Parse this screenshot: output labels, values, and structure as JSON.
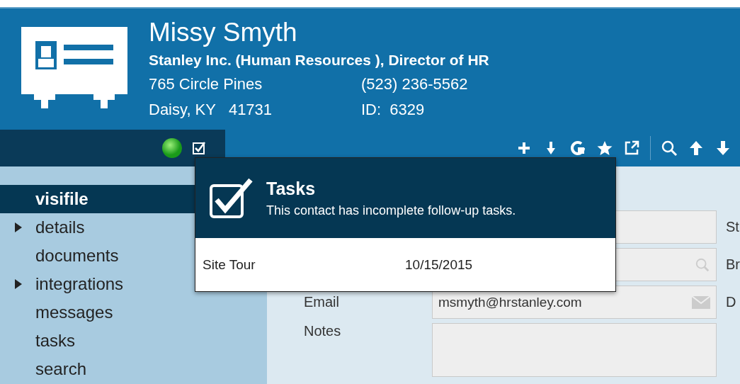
{
  "contact": {
    "name": "Missy Smyth",
    "company_line": "Stanley Inc.  (Human Resources ), Director of HR",
    "address_1": "765 Circle Pines",
    "address_2": "Daisy, KY   41731",
    "phone": "(523) 236-5562",
    "id": "ID:  6329"
  },
  "sidebar": {
    "items": [
      {
        "label": "visifile",
        "selected": true,
        "expandable": false
      },
      {
        "label": "details",
        "selected": false,
        "expandable": true
      },
      {
        "label": "documents",
        "selected": false,
        "expandable": false
      },
      {
        "label": "integrations",
        "selected": false,
        "expandable": true
      },
      {
        "label": "messages",
        "selected": false,
        "expandable": false
      },
      {
        "label": "tasks",
        "selected": false,
        "expandable": false
      },
      {
        "label": "search",
        "selected": false,
        "expandable": false
      }
    ]
  },
  "form": {
    "rows": [
      {
        "kind": "text",
        "side_label": "St"
      },
      {
        "kind": "lookup",
        "side_label": "Br"
      },
      {
        "kind": "email",
        "label": "Email",
        "value": "msmyth@hrstanley.com",
        "side_label": "D"
      },
      {
        "kind": "notes",
        "label": "Notes"
      }
    ]
  },
  "popup": {
    "title": "Tasks",
    "message": "This contact has incomplete follow-up tasks.",
    "tasks": [
      {
        "name": "Site Tour",
        "date": "10/15/2015"
      }
    ]
  }
}
